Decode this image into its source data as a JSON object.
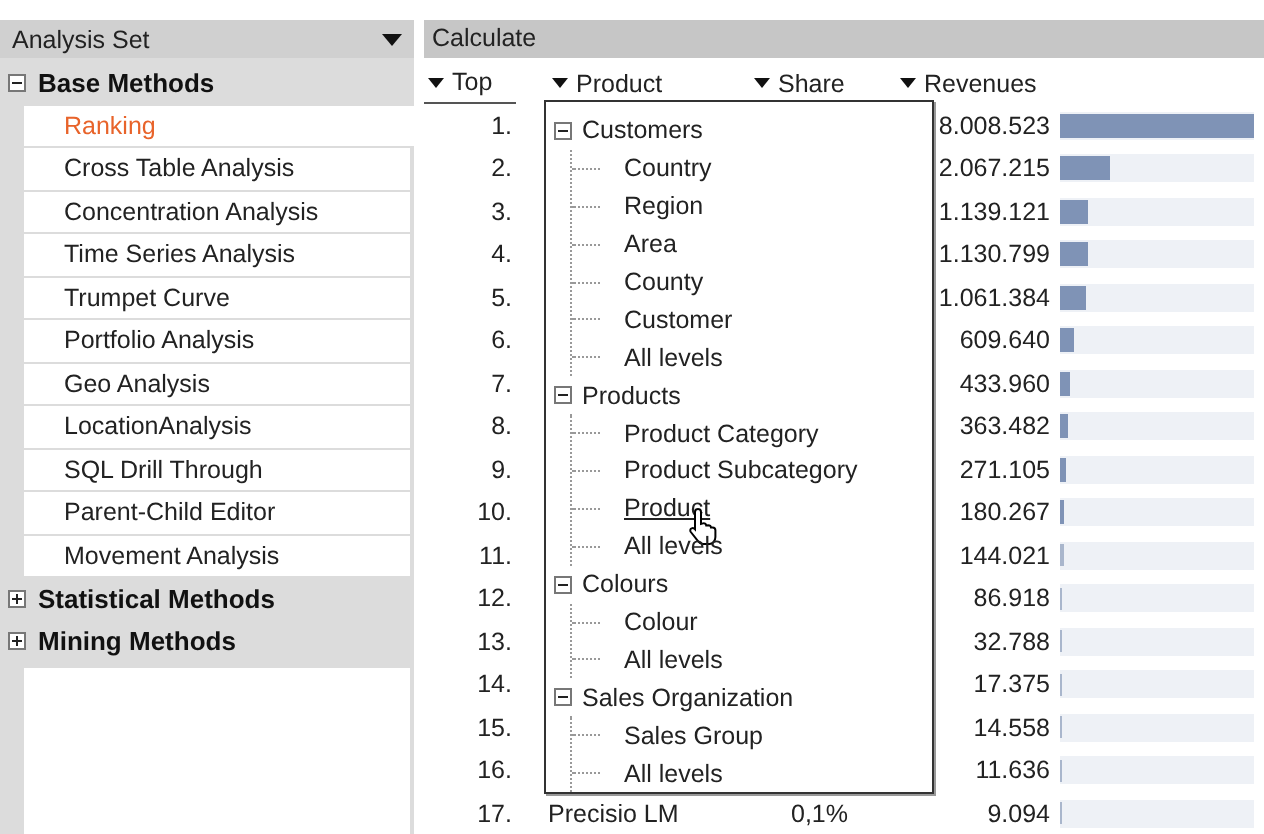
{
  "sidebar": {
    "title": "Analysis Set",
    "groups": [
      {
        "label": "Base Methods",
        "expanded": true,
        "items": [
          {
            "label": "Ranking",
            "selected": true
          },
          {
            "label": "Cross Table Analysis",
            "selected": false
          },
          {
            "label": "Concentration Analysis",
            "selected": false
          },
          {
            "label": "Time Series Analysis",
            "selected": false
          },
          {
            "label": "Trumpet Curve",
            "selected": false
          },
          {
            "label": "Portfolio Analysis",
            "selected": false
          },
          {
            "label": "Geo Analysis",
            "selected": false
          },
          {
            "label": "LocationAnalysis",
            "selected": false
          },
          {
            "label": "SQL Drill Through",
            "selected": false
          },
          {
            "label": "Parent-Child Editor",
            "selected": false
          },
          {
            "label": "Movement Analysis",
            "selected": false
          }
        ]
      },
      {
        "label": "Statistical Methods",
        "expanded": false
      },
      {
        "label": "Mining Methods",
        "expanded": false
      }
    ]
  },
  "toolbar": {
    "title": "Calculate"
  },
  "table": {
    "columns": [
      "Top",
      "Product",
      "Share",
      "Revenues"
    ],
    "rows": [
      {
        "rank": "1.",
        "revenue": "8.008.523",
        "level": 1
      },
      {
        "rank": "2.",
        "revenue": "2.067.215",
        "level": 0.258
      },
      {
        "rank": "3.",
        "revenue": "1.139.121",
        "level": 0.142
      },
      {
        "rank": "4.",
        "revenue": "1.130.799",
        "level": 0.141
      },
      {
        "rank": "5.",
        "revenue": "1.061.384",
        "level": 0.133
      },
      {
        "rank": "6.",
        "revenue": "609.640",
        "level": 0.076
      },
      {
        "rank": "7.",
        "revenue": "433.960",
        "level": 0.054
      },
      {
        "rank": "8.",
        "revenue": "363.482",
        "level": 0.045
      },
      {
        "rank": "9.",
        "revenue": "271.105",
        "level": 0.034
      },
      {
        "rank": "10.",
        "revenue": "180.267",
        "level": 0.023
      },
      {
        "rank": "11.",
        "revenue": "144.021",
        "level": 0.018
      },
      {
        "rank": "12.",
        "revenue": "86.918",
        "level": 0.011
      },
      {
        "rank": "13.",
        "revenue": "32.788",
        "level": 0.004
      },
      {
        "rank": "14.",
        "revenue": "17.375",
        "level": 0.002
      },
      {
        "rank": "15.",
        "revenue": "14.558",
        "level": 0.002
      },
      {
        "rank": "16.",
        "revenue": "11.636",
        "level": 0.001
      },
      {
        "rank": "17.",
        "product": "Precisio LM",
        "share": "0,1%",
        "revenue": "9.094",
        "level": 0.001
      }
    ]
  },
  "dropdown": {
    "groups": [
      {
        "label": "Customers",
        "expanded": true,
        "children": [
          {
            "label": "Country",
            "hovered": false
          },
          {
            "label": "Region",
            "hovered": false
          },
          {
            "label": "Area",
            "hovered": false
          },
          {
            "label": "County",
            "hovered": false
          },
          {
            "label": "Customer",
            "hovered": false
          },
          {
            "label": "All levels",
            "hovered": false
          }
        ]
      },
      {
        "label": "Products",
        "expanded": true,
        "children": [
          {
            "label": "Product Category",
            "hovered": false
          },
          {
            "label": "Product Subcategory",
            "hovered": false
          },
          {
            "label": "Product",
            "hovered": true
          },
          {
            "label": "All levels",
            "hovered": false
          }
        ]
      },
      {
        "label": "Colours",
        "expanded": true,
        "children": [
          {
            "label": "Colour",
            "hovered": false
          },
          {
            "label": "All levels",
            "hovered": false
          }
        ]
      },
      {
        "label": "Sales Organization",
        "expanded": true,
        "children": [
          {
            "label": "Sales Group",
            "hovered": false
          },
          {
            "label": "All levels",
            "hovered": false
          }
        ]
      }
    ]
  }
}
